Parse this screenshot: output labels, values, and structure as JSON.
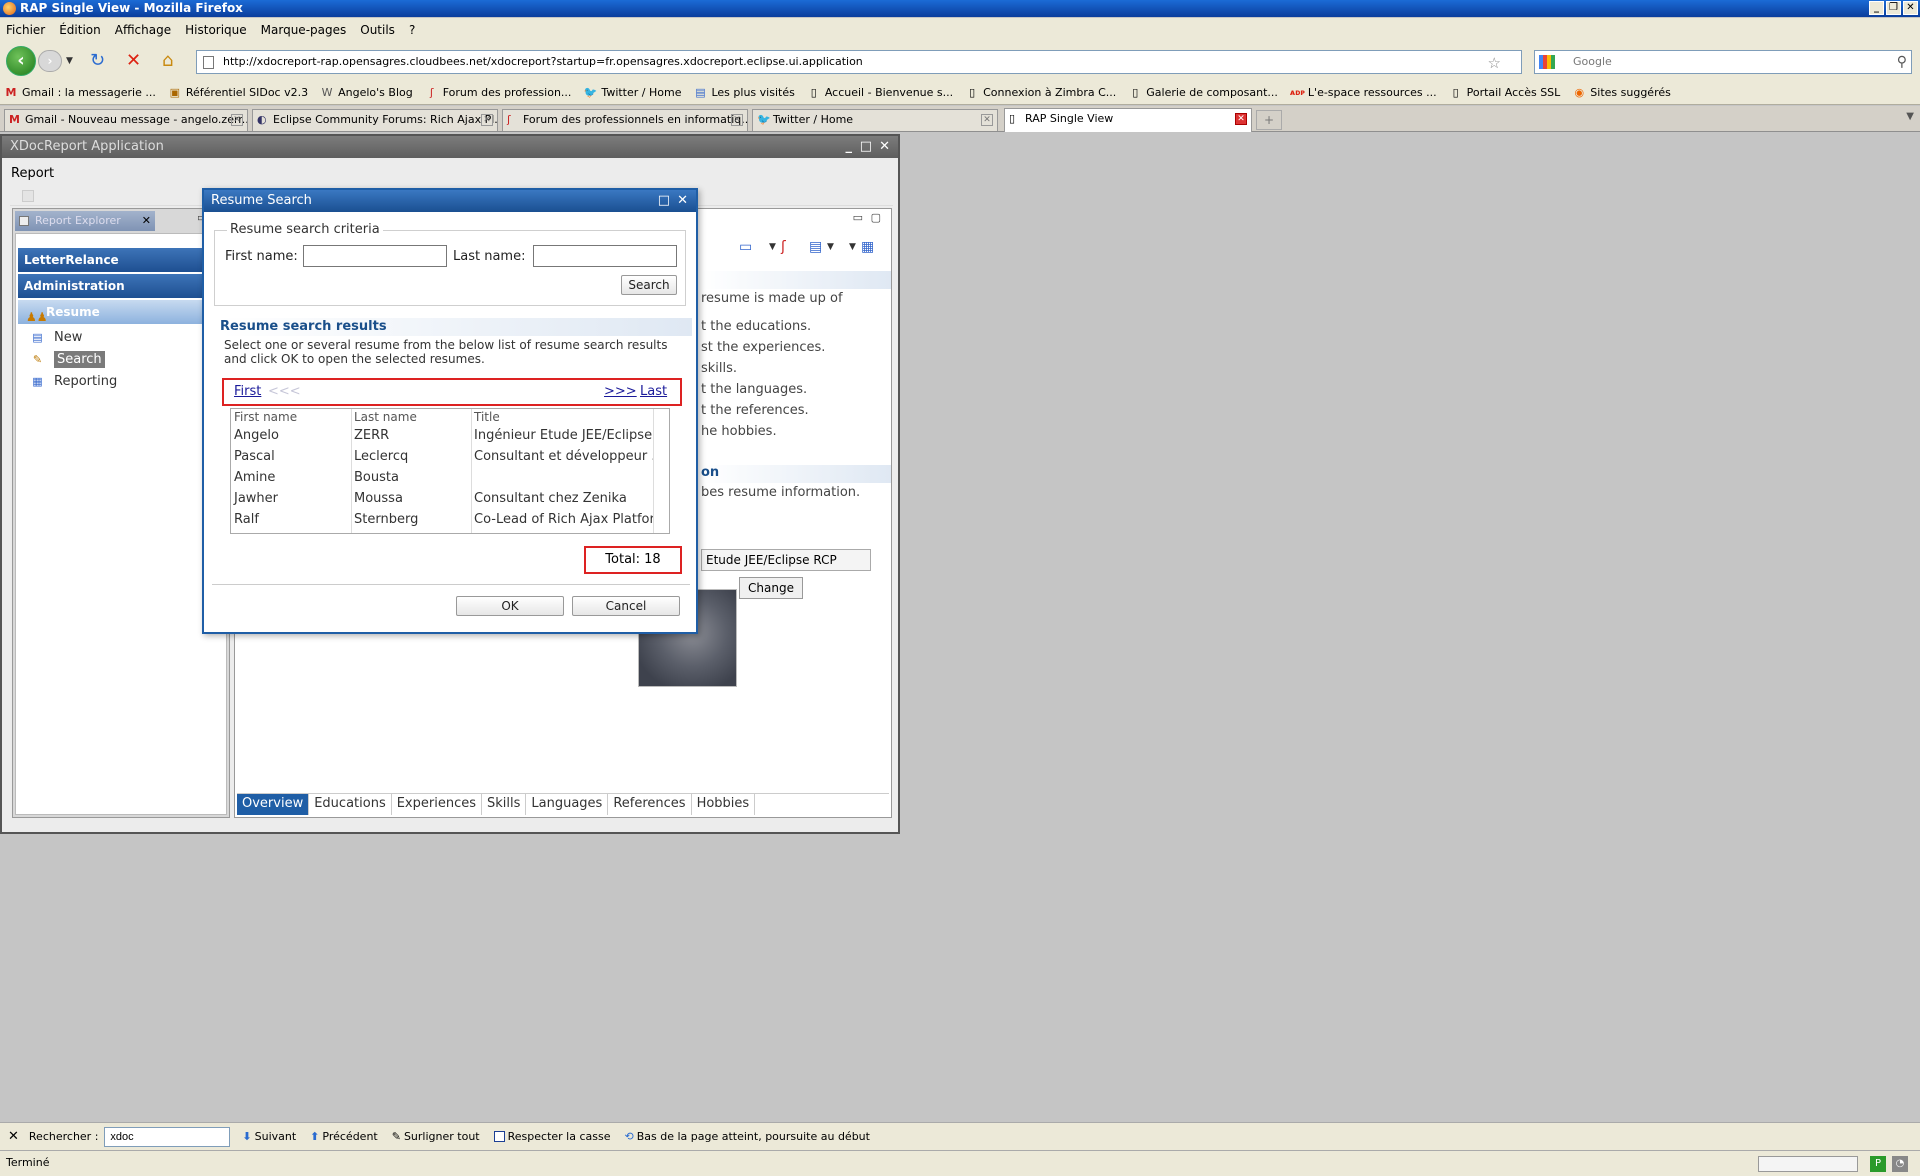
{
  "browser": {
    "window_title": "RAP Single View - Mozilla Firefox",
    "menu": [
      "Fichier",
      "Édition",
      "Affichage",
      "Historique",
      "Marque-pages",
      "Outils",
      "?"
    ],
    "url": "http://xdocreport-rap.opensagres.cloudbees.net/xdocreport?startup=fr.opensagres.xdocreport.eclipse.ui.application",
    "search_placeholder": "Google",
    "bookmarks": [
      {
        "label": "Gmail : la messagerie ...",
        "icon": "M"
      },
      {
        "label": "Référentiel SIDoc v2.3",
        "icon": "▣"
      },
      {
        "label": "Angelo's Blog",
        "icon": "W"
      },
      {
        "label": "Forum des profession...",
        "icon": "ʃ"
      },
      {
        "label": "Twitter / Home",
        "icon": "🐦"
      },
      {
        "label": "Les plus visités",
        "icon": "▤"
      },
      {
        "label": "Accueil - Bienvenue s...",
        "icon": "▯"
      },
      {
        "label": "Connexion à Zimbra C...",
        "icon": "▯"
      },
      {
        "label": "Galerie de composant...",
        "icon": "▯"
      },
      {
        "label": "L'e-space ressources ...",
        "icon": "ᴀᴅᴘ"
      },
      {
        "label": "Portail Accès SSL",
        "icon": "▯"
      },
      {
        "label": "Sites suggérés",
        "icon": "◉"
      }
    ],
    "tabs": [
      {
        "label": "Gmail - Nouveau message - angelo.zerr...",
        "icon": "M"
      },
      {
        "label": "Eclipse Community Forums: Rich Ajax Pl...",
        "icon": "◐"
      },
      {
        "label": "Forum des professionnels en informatiq...",
        "icon": "ʃ"
      },
      {
        "label": "Twitter / Home",
        "icon": "🐦"
      },
      {
        "label": "RAP Single View",
        "icon": "▯"
      }
    ],
    "new_tab": "+",
    "find": {
      "label": "Rechercher :",
      "value": "xdoc",
      "next": "Suivant",
      "previous": "Précédent",
      "highlight": "Surligner tout",
      "match_case": "Respecter la casse",
      "message": "Bas de la page atteint, poursuite au début"
    },
    "status": "Terminé"
  },
  "app": {
    "title": "XDocReport Application",
    "menu_report": "Report",
    "view_tab_label": "Report Explorer",
    "groups": [
      "LetterRelance",
      "Administration",
      "Resume"
    ],
    "nav_items": [
      {
        "label": "New",
        "icon": "▤"
      },
      {
        "label": "Search",
        "icon": "✎"
      },
      {
        "label": "Reporting",
        "icon": "▦"
      }
    ],
    "editor": {
      "overview_lines": [
        "resume is made up of",
        "t the educations.",
        "st the experiences.",
        "skills.",
        "t the languages.",
        "t the references.",
        "he hobbies."
      ],
      "section2_title": "on",
      "section2_text": "bes resume information.",
      "title_value": "Etude JEE/Eclipse RCP",
      "change_label": "Change",
      "bottom_tabs": [
        "Overview",
        "Educations",
        "Experiences",
        "Skills",
        "Languages",
        "References",
        "Hobbies"
      ]
    }
  },
  "dialog": {
    "title": "Resume Search",
    "criteria_legend": "Resume search criteria",
    "first_name_label": "First name:",
    "last_name_label": "Last name:",
    "first_name_value": "",
    "last_name_value": "",
    "search_label": "Search",
    "results_title": "Resume search results",
    "results_desc": "Select one or several resume from the below list of resume search results and click OK to open the selected resumes.",
    "pager": {
      "first": "First",
      "prev": "<<<",
      "next": ">>>",
      "last": "Last"
    },
    "columns": [
      "First name",
      "Last name",
      "Title"
    ],
    "rows": [
      [
        "Angelo",
        "ZERR",
        "Ingénieur Etude JEE/Eclipse"
      ],
      [
        "Pascal",
        "Leclercq",
        "Consultant et développeur ..."
      ],
      [
        "Amine",
        "Bousta",
        ""
      ],
      [
        "Jawher",
        "Moussa",
        "Consultant chez Zenika"
      ],
      [
        "Ralf",
        "Sternberg",
        "Co-Lead of Rich Ajax Platfor"
      ]
    ],
    "total": "Total: 18",
    "ok_label": "OK",
    "cancel_label": "Cancel"
  }
}
